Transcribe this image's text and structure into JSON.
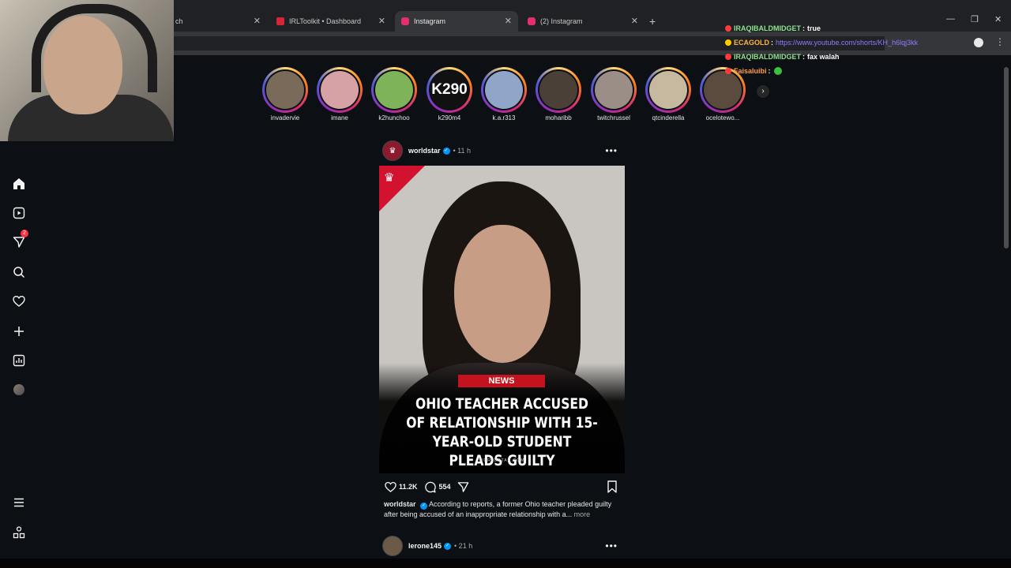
{
  "browser": {
    "tabs": [
      {
        "title": "ch",
        "favicon_color": "#9146ff"
      },
      {
        "title": "IRLToolkit • Dashboard",
        "favicon_color": "#d6263a"
      },
      {
        "title": "Instagram",
        "favicon_color": "#e1306c"
      },
      {
        "title": "(2) Instagram",
        "favicon_color": "#e1306c"
      }
    ],
    "new_tab": "+",
    "close_glyph": "✕",
    "window_controls": {
      "minimize": "—",
      "restore": "❐",
      "close": "✕"
    }
  },
  "sidebar": {
    "items": [
      {
        "name": "home",
        "icon": "home-icon"
      },
      {
        "name": "reels",
        "icon": "reels-icon"
      },
      {
        "name": "messages",
        "icon": "send-icon",
        "badge": "2"
      },
      {
        "name": "search",
        "icon": "search-icon"
      },
      {
        "name": "notifications",
        "icon": "heart-icon"
      },
      {
        "name": "create",
        "icon": "plus-icon"
      },
      {
        "name": "dashboard",
        "icon": "chart-icon"
      },
      {
        "name": "profile",
        "icon": "avatar"
      },
      {
        "name": "more",
        "icon": "menu-icon"
      },
      {
        "name": "also-from-meta",
        "icon": "apps-icon"
      }
    ]
  },
  "stories": [
    {
      "name": "invadervie",
      "color": "#7a6a5a",
      "text": ""
    },
    {
      "name": "imane",
      "color": "#d7a2a6",
      "text": ""
    },
    {
      "name": "k2hunchoo",
      "color": "#7fb35a",
      "text": ""
    },
    {
      "name": "k290m4",
      "color": "#111111",
      "text": "K290"
    },
    {
      "name": "k.a.r313",
      "color": "#8fa6c8",
      "text": ""
    },
    {
      "name": "moharibb",
      "color": "#4b4038",
      "text": ""
    },
    {
      "name": "twitchrussel",
      "color": "#9a8e86",
      "text": ""
    },
    {
      "name": "qtcinderella",
      "color": "#c7b9a0",
      "text": ""
    },
    {
      "name": "ocelotewo...",
      "color": "#5b4a3e",
      "text": ""
    }
  ],
  "stories_next": "›",
  "post": {
    "username": "worldstar",
    "time": "• 11 h",
    "more": "•••",
    "news_tag": "NEWS",
    "headline": "OHIO TEACHER ACCUSED OF RELATIONSHIP WITH 15-YEAR-OLD STUDENT PLEADS GUILTY",
    "watermark": "WORLDSTAR.COM",
    "likes": "11.2K",
    "comments": "554",
    "caption": "According to reports, a former Ohio teacher pleaded guilty after being accused of an inappropriate relationship with a...",
    "more_link": "more"
  },
  "post2": {
    "username": "lerone145",
    "time": "• 21 h",
    "more": "•••"
  },
  "chat": [
    {
      "user": "IRAQIBALDMIDGET",
      "user_color": "#8fe38f",
      "sep": ":",
      "message": "true",
      "link": "",
      "badge_color": "#ff3b3b"
    },
    {
      "user": "ECAGOLD",
      "user_color": "#ffb347",
      "sep": ":",
      "message": "",
      "link": "https://www.youtube.com/shorts/KH_h6lqj3kk",
      "badge_color": "#ffcc00"
    },
    {
      "user": "IRAQIBALDMIDGET",
      "user_color": "#8fe38f",
      "sep": ":",
      "message": "fax walah",
      "link": "",
      "badge_color": "#ff3b3b"
    },
    {
      "user": "Faisaluibi",
      "user_color": "#ff9f43",
      "sep": ":",
      "message": "",
      "link": "",
      "badge_color": "#ff3b3b",
      "emote": "💬"
    }
  ]
}
